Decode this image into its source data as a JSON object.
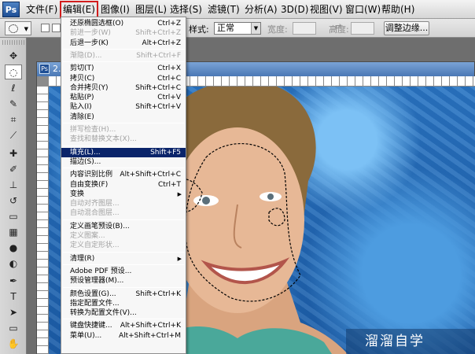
{
  "app": {
    "logo": "Ps"
  },
  "menubar": {
    "items": [
      "文件(F)",
      "编辑(E)",
      "图像(I)",
      "图层(L)",
      "选择(S)",
      "滤镜(T)",
      "分析(A)",
      "3D(D)",
      "视图(V)",
      "窗口(W)",
      "帮助(H)"
    ],
    "active": "编辑(E)",
    "active_outline_color": "#d21d1d"
  },
  "options_bar": {
    "style_label": "样式:",
    "style_value": "正常",
    "width_label": "宽度:",
    "height_label": "高度:",
    "refine_edge_label": "调整边缘..."
  },
  "document": {
    "title": "2.j..."
  },
  "edit_menu": {
    "highlight_color": "#0a246a",
    "items": [
      {
        "label": "还原椭圆选框(O)",
        "shortcut": "Ctrl+Z",
        "enabled": true
      },
      {
        "label": "前进一步(W)",
        "shortcut": "Shift+Ctrl+Z",
        "enabled": false
      },
      {
        "label": "后退一步(K)",
        "shortcut": "Alt+Ctrl+Z",
        "enabled": true
      },
      {
        "separator": true
      },
      {
        "label": "渐隐(D)...",
        "shortcut": "Shift+Ctrl+F",
        "enabled": false
      },
      {
        "separator": true
      },
      {
        "label": "剪切(T)",
        "shortcut": "Ctrl+X",
        "enabled": true
      },
      {
        "label": "拷贝(C)",
        "shortcut": "Ctrl+C",
        "enabled": true
      },
      {
        "label": "合并拷贝(Y)",
        "shortcut": "Shift+Ctrl+C",
        "enabled": true
      },
      {
        "label": "粘贴(P)",
        "shortcut": "Ctrl+V",
        "enabled": true
      },
      {
        "label": "贴入(I)",
        "shortcut": "Shift+Ctrl+V",
        "enabled": true
      },
      {
        "label": "清除(E)",
        "shortcut": "",
        "enabled": true
      },
      {
        "separator": true
      },
      {
        "label": "拼写检查(H)...",
        "shortcut": "",
        "enabled": false
      },
      {
        "label": "查找和替换文本(X)...",
        "shortcut": "",
        "enabled": false
      },
      {
        "separator": true
      },
      {
        "label": "填充(L)...",
        "shortcut": "Shift+F5",
        "enabled": true,
        "highlighted": true
      },
      {
        "label": "描边(S)...",
        "shortcut": "",
        "enabled": true
      },
      {
        "separator": true
      },
      {
        "label": "内容识别比例",
        "shortcut": "Alt+Shift+Ctrl+C",
        "enabled": true
      },
      {
        "label": "自由变换(F)",
        "shortcut": "Ctrl+T",
        "enabled": true
      },
      {
        "label": "变换",
        "shortcut": "",
        "enabled": true,
        "submenu": true
      },
      {
        "label": "自动对齐图层...",
        "shortcut": "",
        "enabled": false
      },
      {
        "label": "自动混合图层...",
        "shortcut": "",
        "enabled": false
      },
      {
        "separator": true
      },
      {
        "label": "定义画笔预设(B)...",
        "shortcut": "",
        "enabled": true
      },
      {
        "label": "定义图案...",
        "shortcut": "",
        "enabled": false
      },
      {
        "label": "定义自定形状...",
        "shortcut": "",
        "enabled": false
      },
      {
        "separator": true
      },
      {
        "label": "清理(R)",
        "shortcut": "",
        "enabled": true,
        "submenu": true
      },
      {
        "separator": true
      },
      {
        "label": "Adobe PDF 预设...",
        "shortcut": "",
        "enabled": true
      },
      {
        "label": "预设管理器(M)...",
        "shortcut": "",
        "enabled": true
      },
      {
        "separator": true
      },
      {
        "label": "颜色设置(G)...",
        "shortcut": "Shift+Ctrl+K",
        "enabled": true
      },
      {
        "label": "指定配置文件...",
        "shortcut": "",
        "enabled": true
      },
      {
        "label": "转换为配置文件(V)...",
        "shortcut": "",
        "enabled": true
      },
      {
        "separator": true
      },
      {
        "label": "键盘快捷键...",
        "shortcut": "Alt+Shift+Ctrl+K",
        "enabled": true
      },
      {
        "label": "菜单(U)...",
        "shortcut": "Alt+Shift+Ctrl+M",
        "enabled": true
      }
    ]
  },
  "watermark": {
    "text": "溜溜自学"
  },
  "tools": [
    "move-tool",
    "marquee-tool",
    "lasso-tool",
    "quick-selection-tool",
    "crop-tool",
    "eyedropper-tool",
    "healing-brush-tool",
    "brush-tool",
    "clone-stamp-tool",
    "history-brush-tool",
    "eraser-tool",
    "gradient-tool",
    "blur-tool",
    "dodge-tool",
    "pen-tool",
    "type-tool",
    "path-selection-tool",
    "shape-tool",
    "3d-rotate-tool",
    "3d-orbit-tool",
    "hand-tool",
    "zoom-tool"
  ]
}
